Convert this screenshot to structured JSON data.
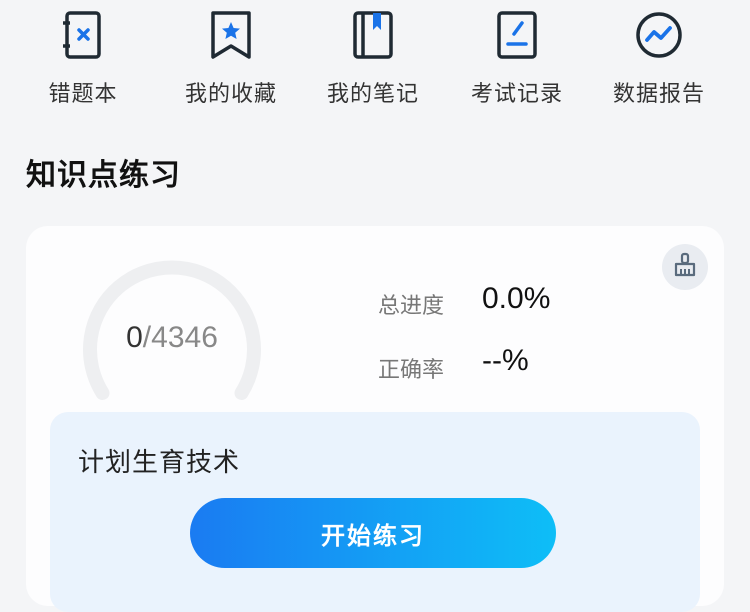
{
  "quick_links": [
    {
      "label": "错题本",
      "icon": "wrong-book-icon"
    },
    {
      "label": "我的收藏",
      "icon": "bookmark-star-icon"
    },
    {
      "label": "我的笔记",
      "icon": "notebook-icon"
    },
    {
      "label": "考试记录",
      "icon": "exam-record-icon"
    },
    {
      "label": "数据报告",
      "icon": "trend-report-icon"
    }
  ],
  "section": {
    "title": "知识点练习"
  },
  "progress": {
    "done": "0",
    "separator": "/",
    "total": "4346",
    "fraction": 0.0,
    "clean_icon": "broom-icon"
  },
  "stats": {
    "progress_label": "总进度",
    "progress_value": "0.0%",
    "accuracy_label": "正确率",
    "accuracy_value": "--%"
  },
  "plan": {
    "name": "计划生育技术",
    "start_label": "开始练习"
  },
  "colors": {
    "accent_start": "#1a7bf2",
    "accent_end": "#0ebef7",
    "icon_dark": "#1f2a33",
    "icon_accent": "#1a73e8",
    "panel_bg": "#eaf3fd"
  }
}
